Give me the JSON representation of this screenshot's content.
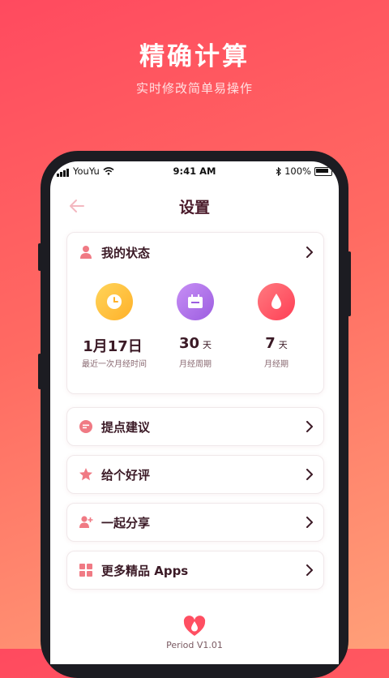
{
  "promo": {
    "title": "精确计算",
    "subtitle": "实时修改简单易操作"
  },
  "status_bar": {
    "carrier": "YouYu",
    "time": "9:41 AM",
    "battery": "100%"
  },
  "nav": {
    "title": "设置",
    "back_icon": "arrow-left-icon"
  },
  "status_card": {
    "title": "我的状态",
    "icon": "person-icon",
    "stats": [
      {
        "value": "1月17日",
        "unit": "",
        "label": "最近一次月经时间",
        "icon": "clock-icon",
        "color": "#ffc23d"
      },
      {
        "value": "30",
        "unit": "天",
        "label": "月经周期",
        "icon": "calendar-icon",
        "color": "#b071e8"
      },
      {
        "value": "7",
        "unit": "天",
        "label": "月经期",
        "icon": "drop-icon",
        "color": "#ff5062"
      }
    ]
  },
  "menu": [
    {
      "label": "提点建议",
      "icon": "message-icon"
    },
    {
      "label": "给个好评",
      "icon": "star-icon"
    },
    {
      "label": "一起分享",
      "icon": "add-user-icon"
    },
    {
      "label": "更多精品 Apps",
      "icon": "grid-icon"
    }
  ],
  "footer": {
    "version": "Period V1.01",
    "logo": "heart-drop-logo-icon"
  },
  "colors": {
    "accent": "#ff4f62",
    "title_text": "#3b1a26"
  }
}
